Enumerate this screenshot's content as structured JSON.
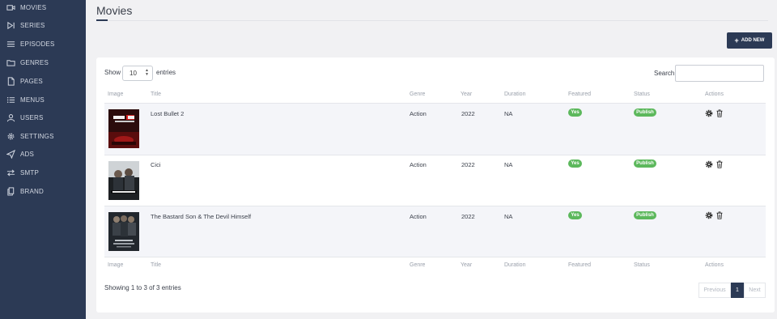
{
  "sidebar": {
    "items": [
      {
        "label": "MOVIES",
        "icon": "video-camera-icon"
      },
      {
        "label": "SERIES",
        "icon": "play-step-icon"
      },
      {
        "label": "EPISODES",
        "icon": "list-icon"
      },
      {
        "label": "GENRES",
        "icon": "folder-icon"
      },
      {
        "label": "PAGES",
        "icon": "file-icon"
      },
      {
        "label": "MENUS",
        "icon": "menu-list-icon"
      },
      {
        "label": "USERS",
        "icon": "user-icon"
      },
      {
        "label": "SETTINGS",
        "icon": "gear-icon"
      },
      {
        "label": "ADS",
        "icon": "paper-plane-icon"
      },
      {
        "label": "SMTP",
        "icon": "exchange-icon"
      },
      {
        "label": "BRAND",
        "icon": "copy-icon"
      }
    ]
  },
  "header": {
    "title": "Movies",
    "add_label": "ADD NEW",
    "add_icon": "plus-icon"
  },
  "table_controls": {
    "show_label": "Show",
    "entries_value": "10",
    "entries_label": "entries",
    "search_label": "Search:",
    "search_value": ""
  },
  "table": {
    "columns": [
      "Image",
      "Title",
      "Genre",
      "Year",
      "Duration",
      "Featured",
      "Status",
      "Actions"
    ],
    "rows": [
      {
        "title": "Lost Bullet 2",
        "genre": "Action",
        "year": "2022",
        "duration": "NA",
        "featured": "Yes",
        "status": "Publish",
        "poster_text": "BALA PERDIDA 2"
      },
      {
        "title": "Cici",
        "genre": "Action",
        "year": "2022",
        "duration": "NA",
        "featured": "Yes",
        "status": "Publish",
        "poster_text": "INNOCENT"
      },
      {
        "title": "The Bastard Son & The Devil Himself",
        "genre": "Action",
        "year": "2022",
        "duration": "NA",
        "featured": "Yes",
        "status": "Publish",
        "poster_text": "THE BASTARD SON & THE DEVIL HIMSELF"
      }
    ]
  },
  "footer": {
    "info": "Showing 1 to 3 of 3 entries",
    "previous": "Previous",
    "page": "1",
    "next": "Next"
  },
  "colors": {
    "sidebar": "#2c3a55",
    "badge_green": "#5cb85c",
    "primary": "#2c3a55"
  }
}
